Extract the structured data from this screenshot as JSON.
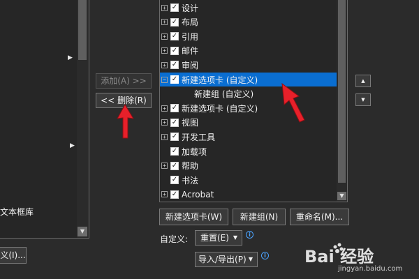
{
  "left_panel": {
    "partial_item": "文本框库",
    "partial_button": "义(I)..."
  },
  "middle": {
    "add_button": "添加(A) >>",
    "remove_button": "<< 删除(R)"
  },
  "tree": {
    "items": [
      {
        "label": "设计",
        "expander": "+",
        "checked": true
      },
      {
        "label": "布局",
        "expander": "+",
        "checked": true
      },
      {
        "label": "引用",
        "expander": "+",
        "checked": true
      },
      {
        "label": "邮件",
        "expander": "+",
        "checked": true
      },
      {
        "label": "审阅",
        "expander": "+",
        "checked": true
      },
      {
        "label": "新建选项卡 (自定义)",
        "expander": "−",
        "checked": true,
        "selected": true
      },
      {
        "label": "新建组 (自定义)",
        "child": true
      },
      {
        "label": "新建选项卡 (自定义)",
        "expander": "+",
        "checked": true
      },
      {
        "label": "视图",
        "expander": "+",
        "checked": true
      },
      {
        "label": "开发工具",
        "expander": "+",
        "checked": true
      },
      {
        "label": "加载项",
        "checked": true
      },
      {
        "label": "帮助",
        "expander": "+",
        "checked": true
      },
      {
        "label": "书法",
        "checked": true
      },
      {
        "label": "Acrobat",
        "expander": "+",
        "checked": true
      }
    ]
  },
  "bottom_buttons": {
    "new_tab": "新建选项卡(W)",
    "new_group": "新建组(N)",
    "rename": "重命名(M)..."
  },
  "customize": {
    "label": "自定义:",
    "reset_button": "重置(E)",
    "import_export_button": "导入/导出(P)"
  },
  "watermark": {
    "brand": "Bai  经验",
    "url": "jingyan.baidu.com"
  },
  "colors": {
    "selection": "#0a6ed1",
    "annotation_arrow": "#e8202a",
    "info": "#4aa3ff"
  }
}
